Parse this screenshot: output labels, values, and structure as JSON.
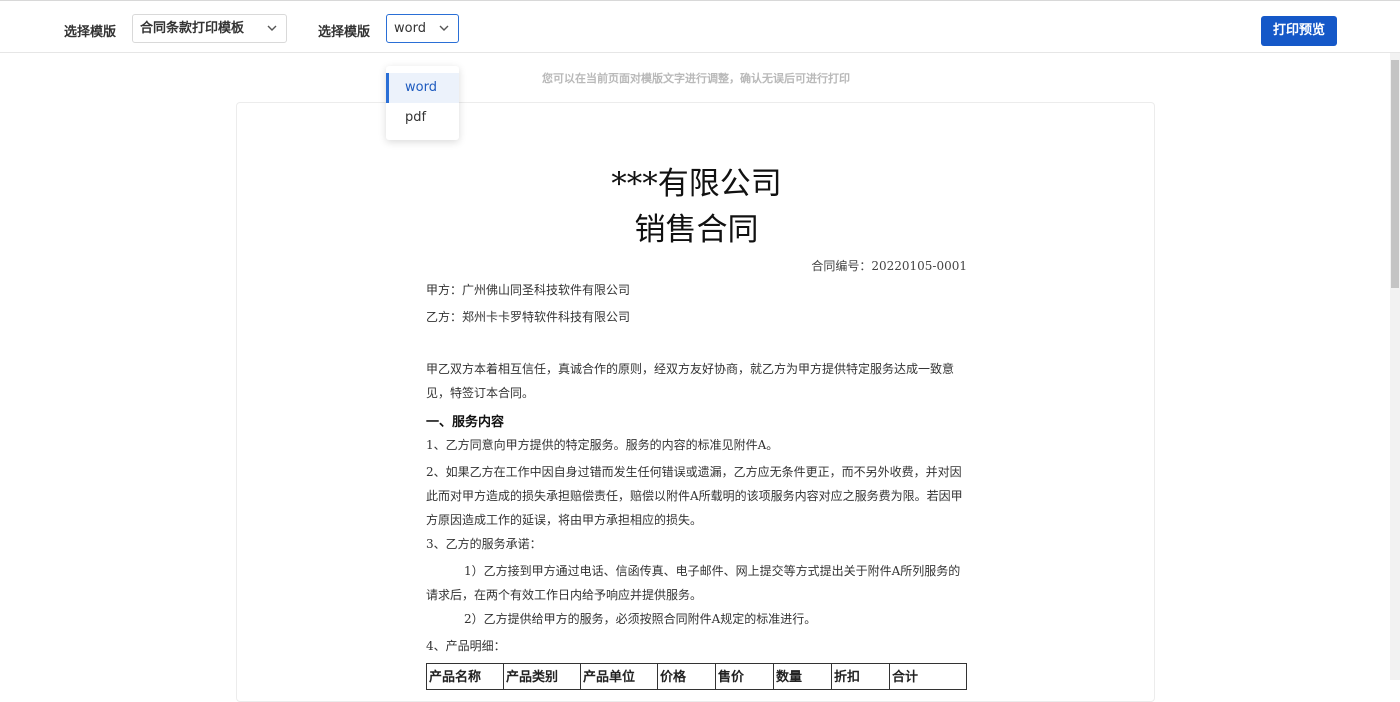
{
  "toolbar": {
    "template_label": "选择模版",
    "template_value": "合同条款打印模板",
    "format_label": "选择模版",
    "format_value": "word",
    "print_preview": "打印预览"
  },
  "hint": "您可以在当前页面对模版文字进行调整，确认无误后可进行打印",
  "format_dropdown": {
    "options": [
      "word",
      "pdf"
    ],
    "selected": "word"
  },
  "document": {
    "company": "***有限公司",
    "title": "销售合同",
    "contract_no": "合同编号：20220105-0001",
    "party_a": "甲方：广州佛山同圣科技软件有限公司",
    "party_b": "乙方：郑州卡卡罗特软件科技有限公司",
    "intro": "甲乙双方本着相互信任，真诚合作的原则，经双方友好协商，就乙方为甲方提供特定服务达成一致意见，特签订本合同。",
    "section1": "一、服务内容",
    "clause1": "1、乙方同意向甲方提供的特定服务。服务的内容的标准见附件A。",
    "clause2": "2、如果乙方在工作中因自身过错而发生任何错误或遗漏，乙方应无条件更正，而不另外收费，并对因此而对甲方造成的损失承担赔偿责任，赔偿以附件A所载明的该项服务内容对应之服务费为限。若因甲方原因造成工作的延误，将由甲方承担相应的损失。",
    "clause3": "3、乙方的服务承诺：",
    "clause3_1": "1）乙方接到甲方通过电话、信函传真、电子邮件、网上提交等方式提出关于附件A所列服务的请求后，在两个有效工作日内给予响应并提供服务。",
    "clause3_2": "2）乙方提供给甲方的服务，必须按照合同附件A规定的标准进行。",
    "clause4": "4、产品明细：",
    "table_headers": [
      "产品名称",
      "产品类别",
      "产品单位",
      "价格",
      "售价",
      "数量",
      "折扣",
      "合计"
    ]
  }
}
